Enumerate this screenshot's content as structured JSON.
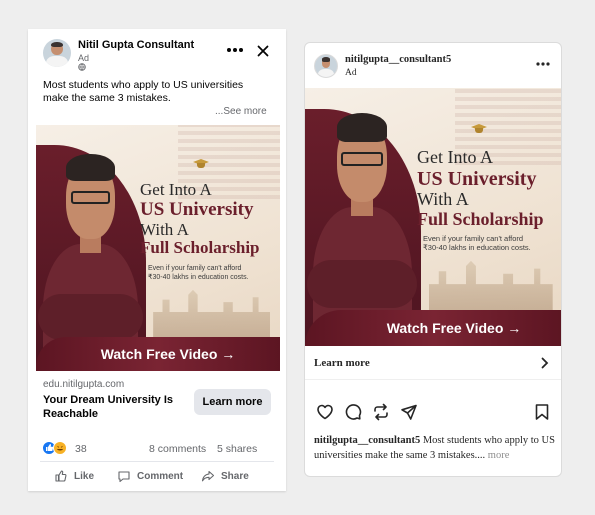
{
  "facebook_ad": {
    "page_name": "Nitil Gupta Consultant",
    "sponsored_label": "Ad",
    "primary_text": "Most students who apply to US universities make the same 3 mistakes.",
    "see_more": "...See more",
    "creative": {
      "headline_line1": "Get Into A",
      "headline_line2": "US University",
      "headline_line3": "With A",
      "headline_line4": "Full Scholarship",
      "subtext_line1": "Even if your family can't afford",
      "subtext_line2": "₹30-40 lakhs in education costs.",
      "cta_banner": "Watch Free Video →"
    },
    "link_domain": "edu.nitilgupta.com",
    "link_title": "Your Dream University Is Reachable",
    "cta_button": "Learn more",
    "reaction_count": "38",
    "comments": "8 comments",
    "shares": "5 shares",
    "actions": {
      "like": "Like",
      "comment": "Comment",
      "share": "Share"
    },
    "colors": {
      "like_blue": "#1877f2",
      "haha_yellow": "#f7b125",
      "maroon": "#6b1f2c"
    }
  },
  "instagram_ad": {
    "username": "nitilgupta__consultant5",
    "sponsored_label": "Ad",
    "creative": {
      "headline_line1": "Get Into A",
      "headline_line2": "US University",
      "headline_line3": "With A",
      "headline_line4": "Full Scholarship",
      "subtext_line1": "Even if your family can't afford",
      "subtext_line2": "₹30-40 lakhs in education costs.",
      "cta_banner": "Watch Free Video →"
    },
    "learn_more": "Learn more",
    "caption_username": "nitilgupta__consultant5",
    "caption_text": " Most students who apply to US universities make the same 3 mistakes....",
    "caption_more": " more",
    "icons": [
      "heart-icon",
      "comment-icon",
      "repost-icon",
      "send-icon",
      "bookmark-icon"
    ]
  }
}
